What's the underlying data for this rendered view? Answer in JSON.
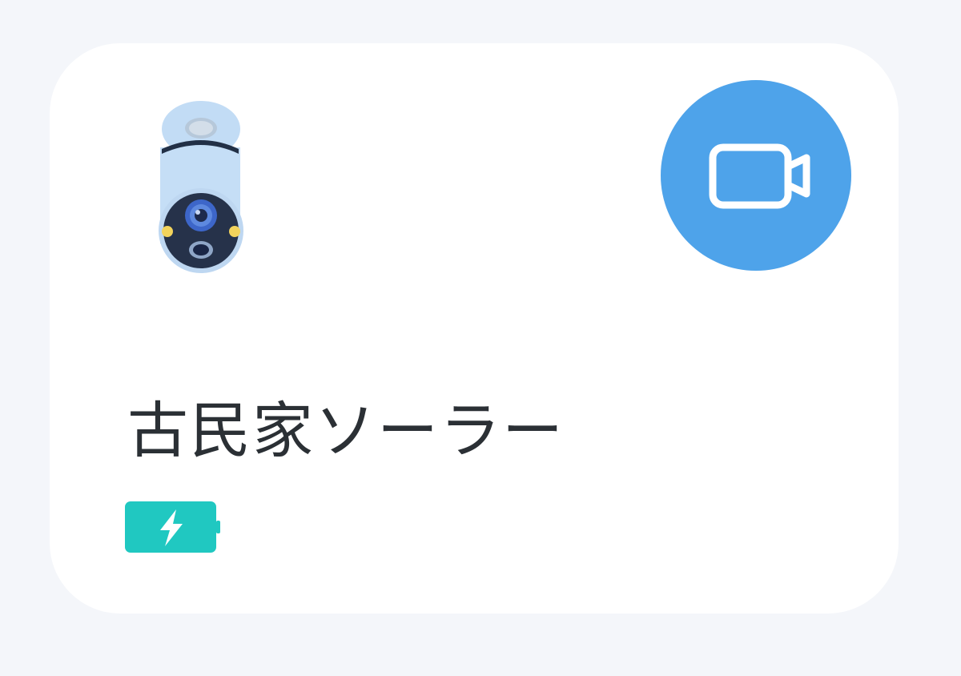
{
  "device": {
    "name": "古民家ソーラー",
    "image_icon": "bullet-camera-icon",
    "battery_status_icon": "battery-charging-icon"
  },
  "actions": {
    "record_icon": "video-camera-icon"
  },
  "colors": {
    "page_background": "#f4f6fa",
    "card_background": "#ffffff",
    "record_button": "#4ea3ea",
    "battery_badge": "#20c8c1",
    "text": "#2b3035"
  }
}
